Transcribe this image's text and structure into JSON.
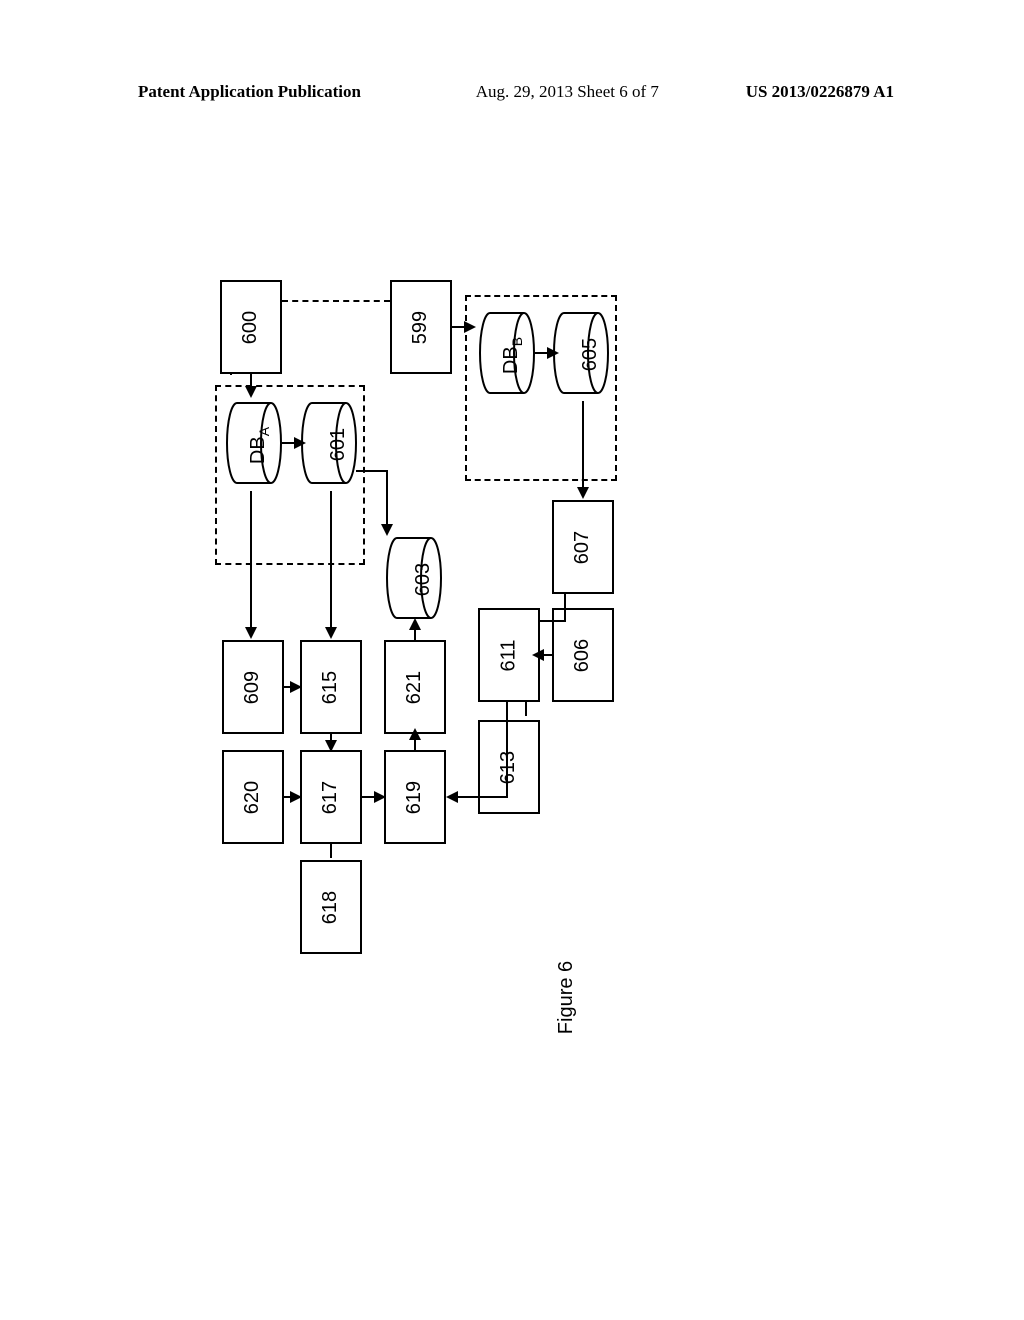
{
  "header": {
    "left": "Patent Application Publication",
    "mid": "Aug. 29, 2013  Sheet 6 of 7",
    "right": "US 2013/0226879 A1"
  },
  "figure_caption": "Figure 6",
  "nodes": {
    "n600": "600",
    "n599": "599",
    "dba": "DB",
    "dba_sub": "A",
    "n601": "601",
    "n603": "603",
    "dbb": "DB",
    "dbb_sub": "B",
    "n605": "605",
    "n609": "609",
    "n615": "615",
    "n621": "621",
    "n607": "607",
    "n620": "620",
    "n617": "617",
    "n619": "619",
    "n611": "611",
    "n606": "606",
    "n618": "618",
    "n613": "613"
  }
}
